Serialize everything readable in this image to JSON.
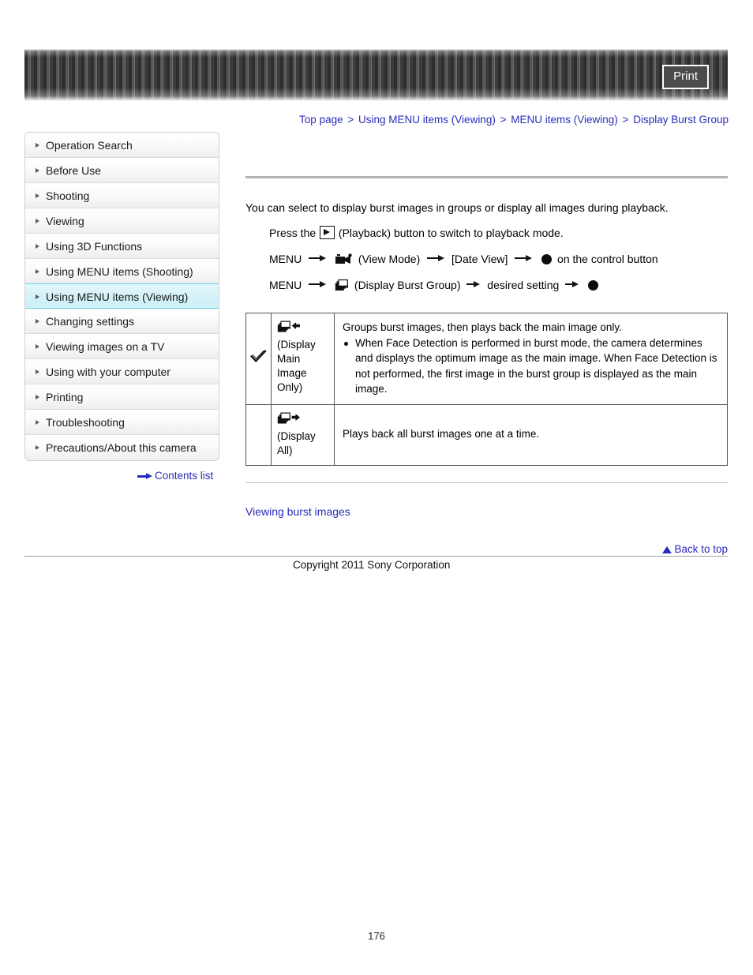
{
  "header": {
    "print_label": "Print"
  },
  "breadcrumb": {
    "separator": ">",
    "items": [
      "Top page",
      "Using MENU items (Viewing)",
      "MENU items (Viewing)",
      "Display Burst Group"
    ]
  },
  "sidebar": {
    "items": [
      {
        "label": "Operation Search",
        "active": false
      },
      {
        "label": "Before Use",
        "active": false
      },
      {
        "label": "Shooting",
        "active": false
      },
      {
        "label": "Viewing",
        "active": false
      },
      {
        "label": "Using 3D Functions",
        "active": false
      },
      {
        "label": "Using MENU items (Shooting)",
        "active": false
      },
      {
        "label": "Using MENU items (Viewing)",
        "active": true
      },
      {
        "label": "Changing settings",
        "active": false
      },
      {
        "label": "Viewing images on a TV",
        "active": false
      },
      {
        "label": "Using with your computer",
        "active": false
      },
      {
        "label": "Printing",
        "active": false
      },
      {
        "label": "Troubleshooting",
        "active": false
      },
      {
        "label": "Precautions/About this camera",
        "active": false
      }
    ],
    "contents_list_label": "Contents list"
  },
  "main": {
    "intro": "You can select to display burst images in groups or display all images during playback.",
    "steps": {
      "step1_pre": "Press the",
      "step1_post": "(Playback) button to switch to playback mode.",
      "step2_menu": "MENU",
      "step2_viewmode": "(View Mode)",
      "step2_dateview": "[Date View]",
      "step2_tail": "on the control button",
      "step3_menu": "MENU",
      "step3_burst": "(Display Burst Group)",
      "step3_desired": "desired setting"
    },
    "table": {
      "rows": [
        {
          "default": true,
          "icon": "display-main-image-only-icon",
          "label": "(Display Main Image Only)",
          "desc": "Groups burst images, then plays back the main image only.",
          "bullets": [
            "When Face Detection is performed in burst mode, the camera determines and displays the optimum image as the main image. When Face Detection is not performed, the first image in the burst group is displayed as the main image."
          ]
        },
        {
          "default": false,
          "icon": "display-all-icon",
          "label": "(Display All)",
          "desc": "Plays back all burst images one at a time.",
          "bullets": []
        }
      ]
    },
    "related_link": "Viewing burst images"
  },
  "footer": {
    "back_to_top": "Back to top",
    "copyright": "Copyright 2011 Sony Corporation",
    "page_number": "176"
  },
  "colors": {
    "link": "#2b2bbb",
    "active_nav_bg": "#d4f2f8",
    "active_nav_border": "#5fd2e8",
    "rule": "#b4b4b4"
  }
}
